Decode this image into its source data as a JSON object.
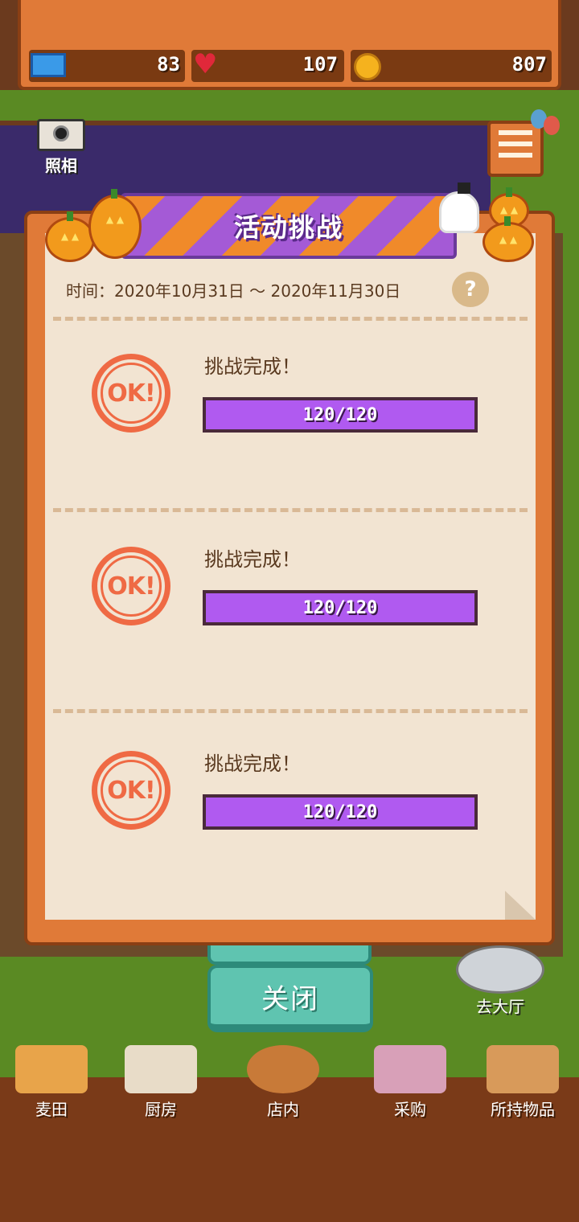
{
  "resources": {
    "tickets": "83",
    "hearts": "107",
    "coins": "807"
  },
  "photo_button_label": "照相",
  "challenge_dialog": {
    "title": "活动挑战",
    "date_range": "时间：2020年10月31日 ～ 2020年11月30日",
    "help_label": "?",
    "challenges": [
      {
        "status": "挑战完成！",
        "stamp": "OK!",
        "progress_text": "120/120",
        "progress_fraction": 1.0
      },
      {
        "status": "挑战完成！",
        "stamp": "OK!",
        "progress_text": "120/120",
        "progress_fraction": 1.0
      },
      {
        "status": "挑战完成！",
        "stamp": "OK!",
        "progress_text": "120/120",
        "progress_fraction": 1.0
      }
    ]
  },
  "close_button_label": "关闭",
  "lobby_button_label": "去大厅",
  "bottom_nav": [
    {
      "label": "麦田",
      "icon": "wheat-field-icon"
    },
    {
      "label": "厨房",
      "icon": "kitchen-icon"
    },
    {
      "label": "店内",
      "icon": "bread-basket-icon"
    },
    {
      "label": "采购",
      "icon": "shop-stalls-icon"
    },
    {
      "label": "所持物品",
      "icon": "box-icon"
    }
  ],
  "colors": {
    "banner_purple": "#a45ad6",
    "banner_orange": "#f08a2a",
    "stamp_red": "#ef6a44",
    "progress_purple": "#a14ae0",
    "close_teal": "#5fc4b0"
  }
}
